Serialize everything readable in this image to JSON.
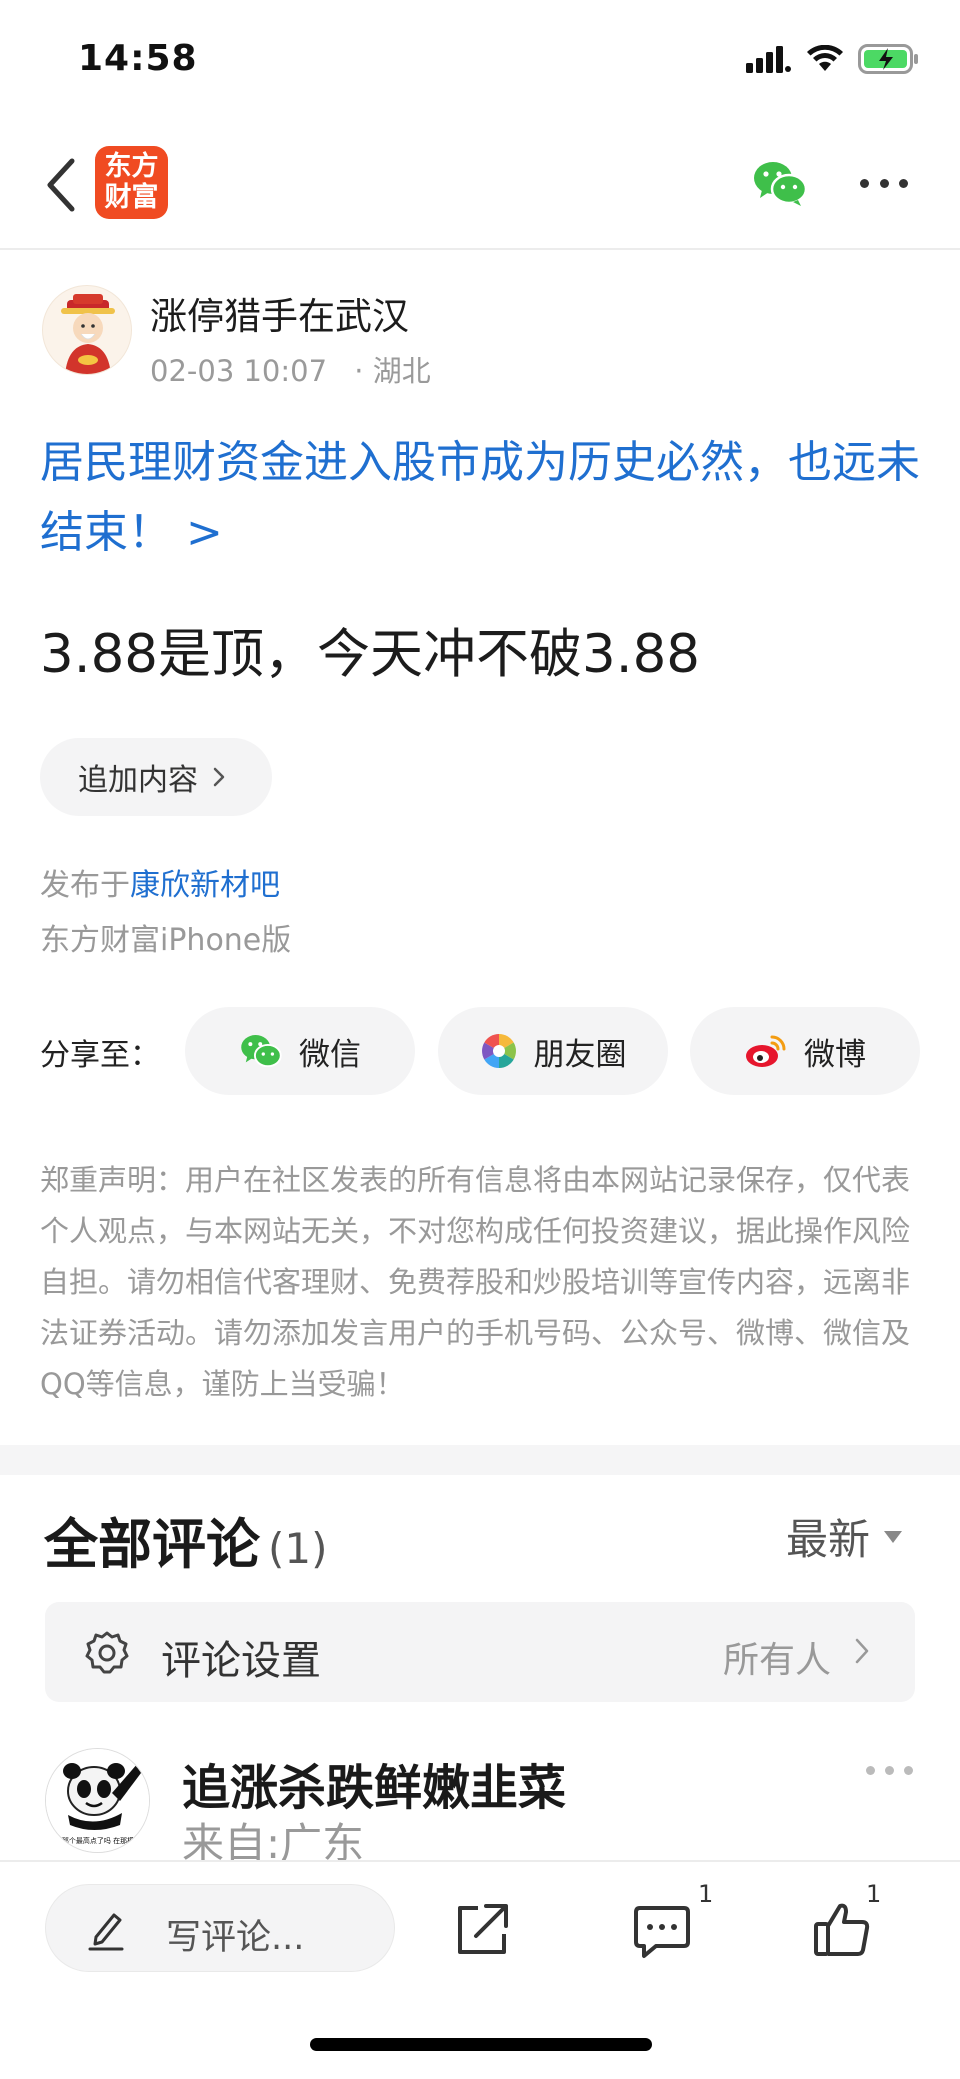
{
  "status_bar": {
    "time": "14:58"
  },
  "nav": {
    "logo_line1": "东方",
    "logo_line2": "财富"
  },
  "post": {
    "author": "涨停猎手在武汉",
    "datetime": "02-03 10:07",
    "location": "· 湖北",
    "title": "居民理财资金进入股市成为历史必然，也远未结束！ >",
    "body": "3.88是顶，今天冲不破3.88",
    "append_label": "追加内容",
    "posted_in_prefix": "发布于",
    "posted_in_bar": "康欣新材吧",
    "client": "东方财富iPhone版"
  },
  "share": {
    "label": "分享至：",
    "wechat": "微信",
    "moments": "朋友圈",
    "weibo": "微博"
  },
  "disclaimer": "郑重声明：用户在社区发表的所有信息将由本网站记录保存，仅代表个人观点，与本网站无关，不对您构成任何投资建议，据此操作风险自担。请勿相信代客理财、免费荐股和炒股培训等宣传内容，远离非法证券活动。请勿添加发言用户的手机号码、公众号、微博、微信及QQ等信息，谨防上当受骗！",
  "comments": {
    "title": "全部评论",
    "count": "(1)",
    "sort": "最新",
    "settings_label": "评论设置",
    "settings_value": "所有人",
    "items": [
      {
        "user": "追涨杀跌鲜嫩韭菜",
        "location": "来自:广东",
        "avatar_caption": "看到那个最高点了吗 在那模给的"
      }
    ]
  },
  "bottom_bar": {
    "write_placeholder": "写评论...",
    "comment_count": "1",
    "like_count": "1"
  },
  "colors": {
    "link_blue": "#1f6fd0",
    "brand_orange": "#f04b22",
    "wechat_green": "#3fbf4a"
  }
}
